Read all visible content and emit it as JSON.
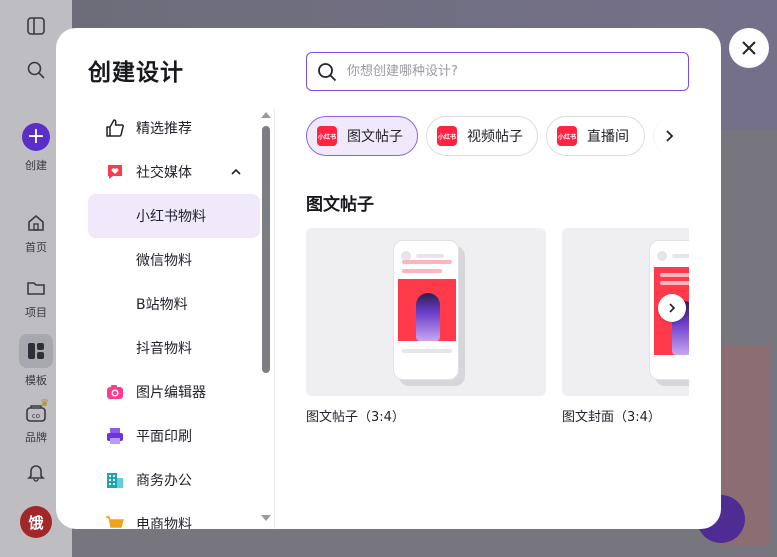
{
  "background_app": {
    "rail": [
      {
        "label": "",
        "icon": "sidebar-toggle-icon"
      },
      {
        "label": "",
        "icon": "search-icon"
      },
      {
        "label": "创建",
        "icon": "plus-icon"
      },
      {
        "label": "首页",
        "icon": "home-icon"
      },
      {
        "label": "项目",
        "icon": "folder-icon"
      },
      {
        "label": "模板",
        "icon": "template-icon"
      },
      {
        "label": "品牌",
        "icon": "brand-icon"
      },
      {
        "label": "",
        "icon": "bell-icon"
      }
    ],
    "avatar_text": "饿"
  },
  "modal": {
    "title": "创建设计",
    "search": {
      "placeholder": "你想创建哪种设计?"
    },
    "nav": [
      {
        "label": "精选推荐",
        "icon": "thumbs-up-icon"
      },
      {
        "label": "社交媒体",
        "icon": "heart-chat-icon",
        "expanded": true
      },
      {
        "label": "小红书物料",
        "sub": true,
        "active": true
      },
      {
        "label": "微信物料",
        "sub": true
      },
      {
        "label": "B站物料",
        "sub": true
      },
      {
        "label": "抖音物料",
        "sub": true
      },
      {
        "label": "图片编辑器",
        "icon": "camera-icon"
      },
      {
        "label": "平面印刷",
        "icon": "printer-icon"
      },
      {
        "label": "商务办公",
        "icon": "office-icon"
      },
      {
        "label": "电商物料",
        "icon": "cart-icon"
      }
    ],
    "chips": [
      {
        "label": "图文帖子",
        "logo": "小红书",
        "active": true
      },
      {
        "label": "视频帖子",
        "logo": "小红书"
      },
      {
        "label": "直播间",
        "logo": "小红书"
      }
    ],
    "section_title": "图文帖子",
    "cards": [
      {
        "label": "图文帖子（3:4）"
      },
      {
        "label": "图文封面（3:4）"
      }
    ]
  },
  "colors": {
    "accent": "#7e4ce0",
    "active_bg": "#efe9fb",
    "xhs_red": "#ff2442"
  }
}
